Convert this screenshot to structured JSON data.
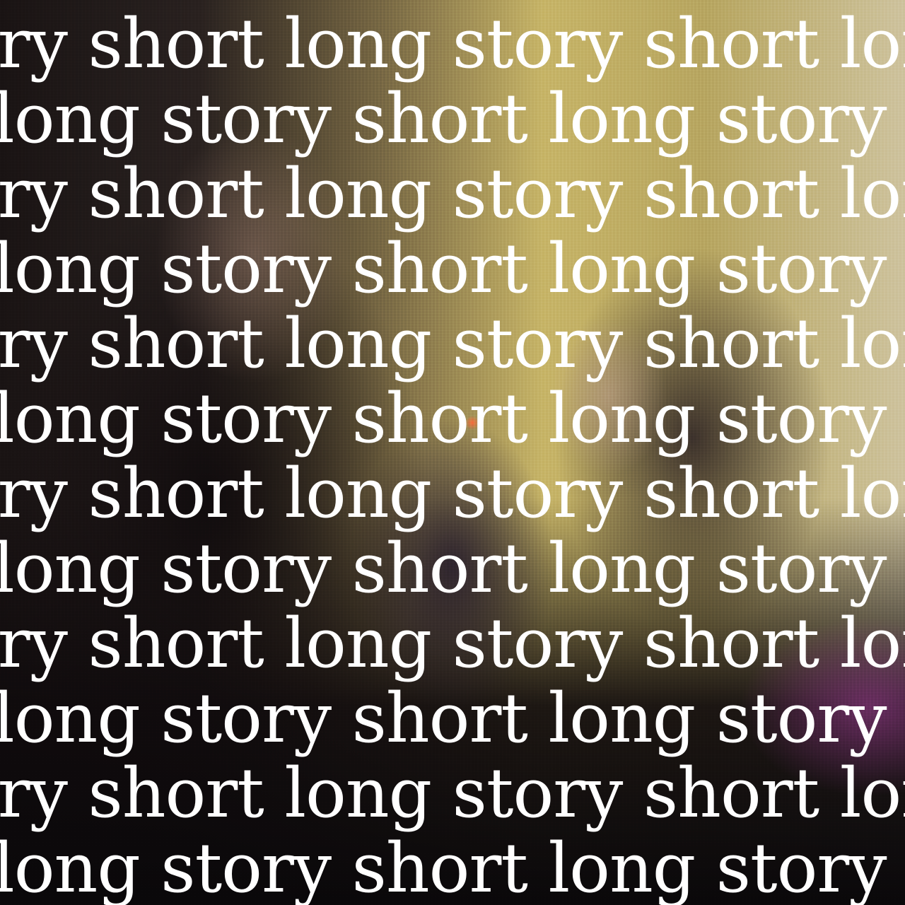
{
  "background": {
    "icon": "photo-background",
    "colors": {
      "wall": "#c8b66a",
      "dark": "#141010",
      "accent_magenta": "#a03c96",
      "ember": "#ff6e3c"
    }
  },
  "text_lines": [
    "ory short long story short long s",
    "long story short long story sho",
    "ory short long story short long s",
    "long story short long story sho",
    "ory short long story short long s",
    "long story short long story sho",
    "ory short long story short long s",
    "long story short long story sho",
    "ory short long story short long s",
    "long story short long story sho",
    "ory short long story short long s",
    "long story short long story sho"
  ]
}
